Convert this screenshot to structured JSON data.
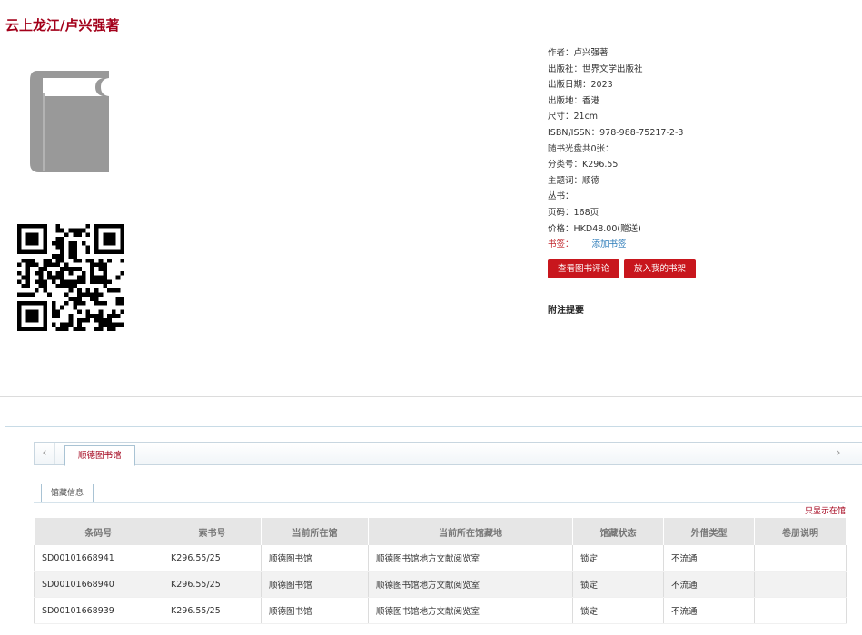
{
  "book": {
    "title": "云上龙江/卢兴强著"
  },
  "icons": {
    "book": "book-icon",
    "qr": "qr-code-icon",
    "left_arrow": "chevron-left-icon",
    "right_arrow": "chevron-right-icon"
  },
  "metadata": [
    "作者：卢兴强著",
    "出版社：世界文学出版社",
    "出版日期：2023",
    "出版地：香港",
    "尺寸：21cm",
    "ISBN/ISSN：978-988-75217-2-3",
    "随书光盘共0张：",
    "分类号：K296.55",
    "主题词：顺德",
    "丛书：",
    "页码：168页",
    "价格：HKD48.00(赠送)"
  ],
  "tags": {
    "label": "书签：",
    "add_link": "添加书签"
  },
  "actions": {
    "view_reviews": "查看图书评论",
    "add_to_shelf": "放入我的书架"
  },
  "notes": {
    "heading": "附注提要"
  },
  "library_tabs": {
    "active": "顺德图书馆",
    "left_arrow": "‹",
    "right_arrow": "›"
  },
  "holdings_section": {
    "subtab": "馆藏信息",
    "only_show_link": "只显示在馆"
  },
  "holdings": {
    "headers": [
      "条码号",
      "索书号",
      "当前所在馆",
      "当前所在馆藏地",
      "馆藏状态",
      "外借类型",
      "卷册说明"
    ],
    "rows": [
      [
        "SD00101668941",
        "K296.55/25",
        "顺德图书馆",
        "顺德图书馆地方文献阅览室",
        "锁定",
        "不流通",
        ""
      ],
      [
        "SD00101668940",
        "K296.55/25",
        "顺德图书馆",
        "顺德图书馆地方文献阅览室",
        "锁定",
        "不流通",
        ""
      ],
      [
        "SD00101668939",
        "K296.55/25",
        "顺德图书馆",
        "顺德图书馆地方文献阅览室",
        "锁定",
        "不流通",
        ""
      ]
    ]
  },
  "colors": {
    "title": "#a3001a",
    "button": "#c8161d",
    "link": "#2a7ab8",
    "icon_gray": "#999999"
  }
}
